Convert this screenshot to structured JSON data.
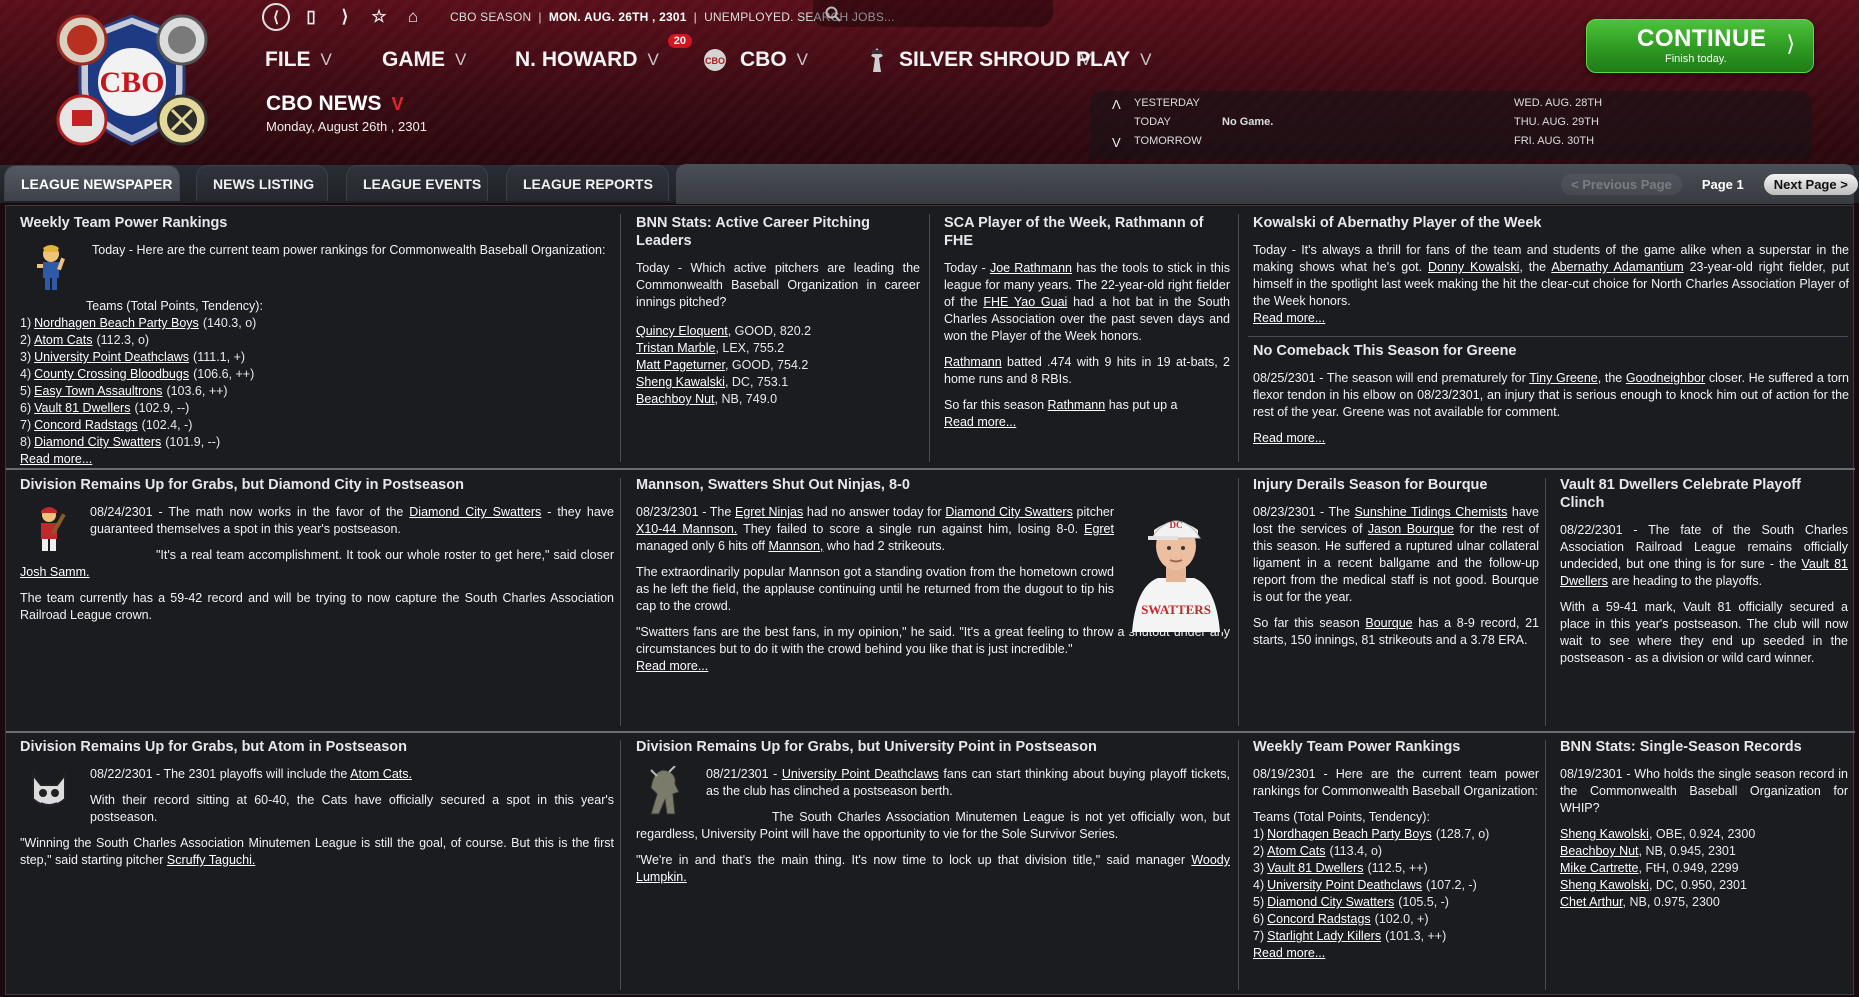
{
  "utility": {
    "back_icon": "back-circle-icon",
    "context": "CBO SEASON",
    "date": "MON. AUG. 26TH , 2301",
    "status": "UNEMPLOYED. SEARCH JOBS...",
    "search_placeholder": ""
  },
  "menu": {
    "file": "FILE",
    "game": "GAME",
    "manager": "N. HOWARD",
    "manager_badge": "20",
    "cbo": "CBO",
    "team": "SILVER SHROUD",
    "play": "PLAY"
  },
  "header": {
    "section": "CBO NEWS",
    "date": "Monday, August 26th , 2301"
  },
  "continue": {
    "label": "CONTINUE",
    "sub": "Finish today."
  },
  "schedule": {
    "yesterday": "YESTERDAY",
    "today": "TODAY",
    "today_game": "No Game.",
    "tomorrow": "TOMORROW",
    "d1": "WED. AUG. 28TH",
    "d2": "THU. AUG. 29TH",
    "d3": "FRI. AUG. 30TH"
  },
  "tabs": [
    "LEAGUE NEWSPAPER",
    "NEWS LISTING",
    "LEAGUE EVENTS",
    "LEAGUE REPORTS"
  ],
  "pager": {
    "prev": "< Previous Page",
    "page": "Page 1",
    "next": "Next Page >"
  },
  "articles": {
    "a1": {
      "title": "Weekly Team Power Rankings",
      "intro": "Today - Here are the current team power rankings for Commonwealth Baseball Organization:",
      "list_head": "Teams (Total Points, Tendency):",
      "items": [
        {
          "n": "1)",
          "team": "Nordhagen Beach Party Boys",
          "val": "(140.3, o)"
        },
        {
          "n": "2)",
          "team": "Atom Cats",
          "val": "(112.3, o)"
        },
        {
          "n": "3)",
          "team": "University Point Deathclaws",
          "val": "(111.1, +)"
        },
        {
          "n": "4)",
          "team": "County Crossing Bloodbugs",
          "val": "(106.6, ++)"
        },
        {
          "n": "5)",
          "team": "Easy Town Assaultrons",
          "val": "(103.6, ++)"
        },
        {
          "n": "6)",
          "team": "Vault 81 Dwellers",
          "val": "(102.9, --)"
        },
        {
          "n": "7)",
          "team": "Concord Radstags",
          "val": "(102.4, -)"
        },
        {
          "n": "8)",
          "team": "Diamond City Swatters",
          "val": "(101.9, --)"
        }
      ],
      "readmore": "Read more..."
    },
    "a2": {
      "title": "BNN Stats: Active Career Pitching Leaders",
      "intro": "Today - Which active pitchers are leading the Commonwealth Baseball Organization in career innings pitched?",
      "items": [
        {
          "name": "Quincy Eloquent",
          "rest": ", GOOD, 820.2"
        },
        {
          "name": "Tristan Marble",
          "rest": ", LEX, 755.2"
        },
        {
          "name": "Matt Pageturner",
          "rest": ", GOOD, 754.2"
        },
        {
          "name": "Sheng Kawalski",
          "rest": ", DC, 753.1"
        },
        {
          "name": "Beachboy Nut",
          "rest": ", NB, 749.0"
        }
      ]
    },
    "a3": {
      "title": "SCA Player of the Week, Rathmann of FHE",
      "p1a": "Today - ",
      "p1_link1": "Joe Rathmann",
      "p1b": " has the tools to stick in this league for many years. The 22-year-old right fielder of the ",
      "p1_link2": "FHE Yao Guai",
      "p1c": " had a hot bat in the South Charles Association over the past seven days and won the Player of the Week honors.",
      "p2_link": "Rathmann",
      "p2": " batted .474 with 9 hits in 19 at-bats, 2 home runs and 8 RBIs.",
      "p3a": "So far this season ",
      "p3_link": "Rathmann",
      "p3b": " has put up a",
      "readmore": "Read more..."
    },
    "a4": {
      "title": "Kowalski of Abernathy Player of the Week",
      "p1a": "Today - It's always a thrill for fans of the team and students of the game alike when a superstar in the making shows what he's got. ",
      "p1_link1": "Donny Kowalski",
      "p1b": ", the ",
      "p1_link2": "Abernathy Adamantium",
      "p1c": " 23-year-old right fielder, put himself in the spotlight last week making the hit the clear-cut choice for North Charles Association Player of the Week honors.",
      "readmore": "Read more..."
    },
    "a5": {
      "title": "No Comeback This Season for Greene",
      "p1a": "08/25/2301 - The season will end prematurely for ",
      "p1_link1": "Tiny Greene",
      "p1b": ", the ",
      "p1_link2": "Goodneighbor",
      "p1c": " closer. He suffered a torn flexor tendon in his elbow on 08/23/2301, an injury that is serious enough to knock him out of action for the rest of the year. Greene was not available for comment.",
      "readmore": "Read more..."
    },
    "a6": {
      "title": "Division Remains Up for Grabs, but Diamond City in Postseason",
      "p1a": "08/24/2301 - The math now works in the favor of the ",
      "p1_link": "Diamond City Swatters",
      "p1b": " - they have guaranteed themselves a spot in this year's postseason.",
      "p2a": "\"It's a real team accomplishment. It took our whole roster to get here,\" said closer ",
      "p2_link": "Josh Samm.",
      "p3": "The team currently has a 59-42 record and will be trying to now capture the South Charles Association Railroad League crown."
    },
    "a7": {
      "title": "Mannson, Swatters Shut Out Ninjas, 8-0",
      "p1a": "08/23/2301 - The ",
      "p1_link1": "Egret Ninjas",
      "p1b": " had no answer today for ",
      "p1_link2": "Diamond City Swatters",
      "p1c": " pitcher ",
      "p1_link3": "X10-44 Mannson.",
      "p1d": " They failed to score a single run against him, losing 8-0. ",
      "p1_link4": "Egret",
      "p1e": " managed only 6 hits off ",
      "p1_link5": "Mannson,",
      "p1f": " who had 2 strikeouts.",
      "p2": "The extraordinarily popular Mannson got a standing ovation from the hometown crowd as he left the field, the applause continuing until he returned from the dugout to tip his cap to the crowd.",
      "p3": "\"Swatters fans are the best fans, in my opinion,\" he said. \"It's a great feeling to throw a shutout under any circumstances but to do it with the crowd behind you like that is just incredible.\"",
      "readmore": "Read more...",
      "jersey": "SWATTERS"
    },
    "a8": {
      "title": "Injury Derails Season for Bourque",
      "p1a": "08/23/2301 - The ",
      "p1_link1": "Sunshine Tidings Chemists",
      "p1b": " have lost the services of ",
      "p1_link2": "Jason Bourque",
      "p1c": " for the rest of this season. He suffered a ruptured ulnar collateral ligament in a recent ballgame and the follow-up report from the medical staff is not good. Bourque is out for the year.",
      "p2a": "So far this season ",
      "p2_link": "Bourque",
      "p2b": " has a 8-9 record, 21 starts, 150 innings, 81 strikeouts and a 3.78 ERA."
    },
    "a9": {
      "title": "Vault 81 Dwellers Celebrate Playoff Clinch",
      "p1a": "08/22/2301 - The fate of the South Charles Association Railroad League remains officially undecided, but one thing is for sure - the ",
      "p1_link": "Vault 81 Dwellers",
      "p1b": " are heading to the playoffs.",
      "p2": "With a 59-41 mark, Vault 81 officially secured a place in this year's postseason. The club will now wait to see where they end up seeded in the postseason - as a division or wild card winner."
    },
    "a10": {
      "title": "Division Remains Up for Grabs, but Atom in Postseason",
      "p1a": "08/22/2301 - The 2301 playoffs will include the ",
      "p1_link": "Atom Cats.",
      "p2": "With their record sitting at 60-40, the Cats have officially secured a spot in this year's postseason.",
      "p3a": "\"Winning the South Charles Association Minutemen League is still the goal, of course. But this is the first step,\" said starting pitcher ",
      "p3_link": "Scruffy Taguchi."
    },
    "a11": {
      "title": "Division Remains Up for Grabs, but University Point in Postseason",
      "p1a": "08/21/2301 - ",
      "p1_link": "University Point Deathclaws",
      "p1b": " fans can start thinking about buying playoff tickets, as the club has clinched a postseason berth.",
      "p2": "The South Charles Association Minutemen League is not yet officially won, but regardless, University Point will have the opportunity to vie for the Sole Survivor Series.",
      "p3a": "\"We're in and that's the main thing. It's now time to lock up that division title,\" said manager ",
      "p3_link": "Woody Lumpkin."
    },
    "a12": {
      "title": "Weekly Team Power Rankings",
      "intro": "08/19/2301 - Here are the current team power rankings for Commonwealth Baseball Organization:",
      "list_head": "Teams (Total Points, Tendency):",
      "items": [
        {
          "n": "1)",
          "team": "Nordhagen Beach Party Boys",
          "val": "(128.7, o)"
        },
        {
          "n": "2)",
          "team": "Atom Cats",
          "val": "(113.4, o)"
        },
        {
          "n": "3)",
          "team": "Vault 81 Dwellers",
          "val": "(112.5, ++)"
        },
        {
          "n": "4)",
          "team": "University Point Deathclaws",
          "val": "(107.2, -)"
        },
        {
          "n": "5)",
          "team": "Diamond City Swatters",
          "val": "(105.5, -)"
        },
        {
          "n": "6)",
          "team": "Concord Radstags",
          "val": "(102.0, +)"
        },
        {
          "n": "7)",
          "team": "Starlight Lady Killers",
          "val": "(101.3, ++)"
        }
      ],
      "readmore": "Read more..."
    },
    "a13": {
      "title": "BNN Stats: Single-Season Records",
      "intro": "08/19/2301 - Who holds the single season record in the Commonwealth Baseball Organization for WHIP?",
      "items": [
        {
          "name": "Sheng Kawolski",
          "rest": ", OBE, 0.924, 2300"
        },
        {
          "name": "Beachboy Nut",
          "rest": ", NB, 0.945, 2301"
        },
        {
          "name": "Mike Cartrette",
          "rest": ", FtH, 0.949, 2299"
        },
        {
          "name": "Sheng Kawolski",
          "rest": ", DC, 0.950, 2301"
        },
        {
          "name": "Chet Arthur",
          "rest": ", NB, 0.975, 2300"
        }
      ]
    }
  },
  "colors": {
    "header_red": "#5a0f1a",
    "continue_green": "#2e9a22",
    "badge_red": "#d0161f",
    "panel_bg": "#1b1c20"
  }
}
